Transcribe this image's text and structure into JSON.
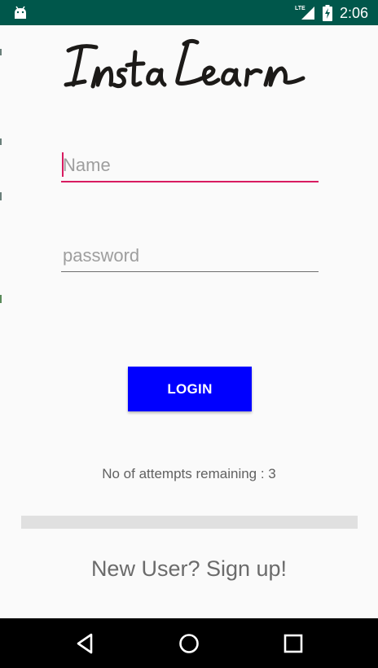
{
  "status_bar": {
    "time": "2:06",
    "network_label": "LTE",
    "icons": [
      "android-icon",
      "lte-signal-icon",
      "battery-charging-icon"
    ],
    "background_color": "#00574B"
  },
  "app": {
    "logo_text": "InstaLearn"
  },
  "login_form": {
    "name_placeholder": "Name",
    "password_placeholder": "password",
    "login_label": "LOGIN",
    "accent_color": "#D81B60",
    "button_color": "#0000FF"
  },
  "attempts": {
    "text": "No of attempts remaining : 3"
  },
  "progress": {
    "value": 0
  },
  "signup": {
    "label": "New User? Sign up!"
  },
  "nav_bar": {
    "buttons": [
      "back-icon",
      "home-icon",
      "recents-icon"
    ]
  }
}
